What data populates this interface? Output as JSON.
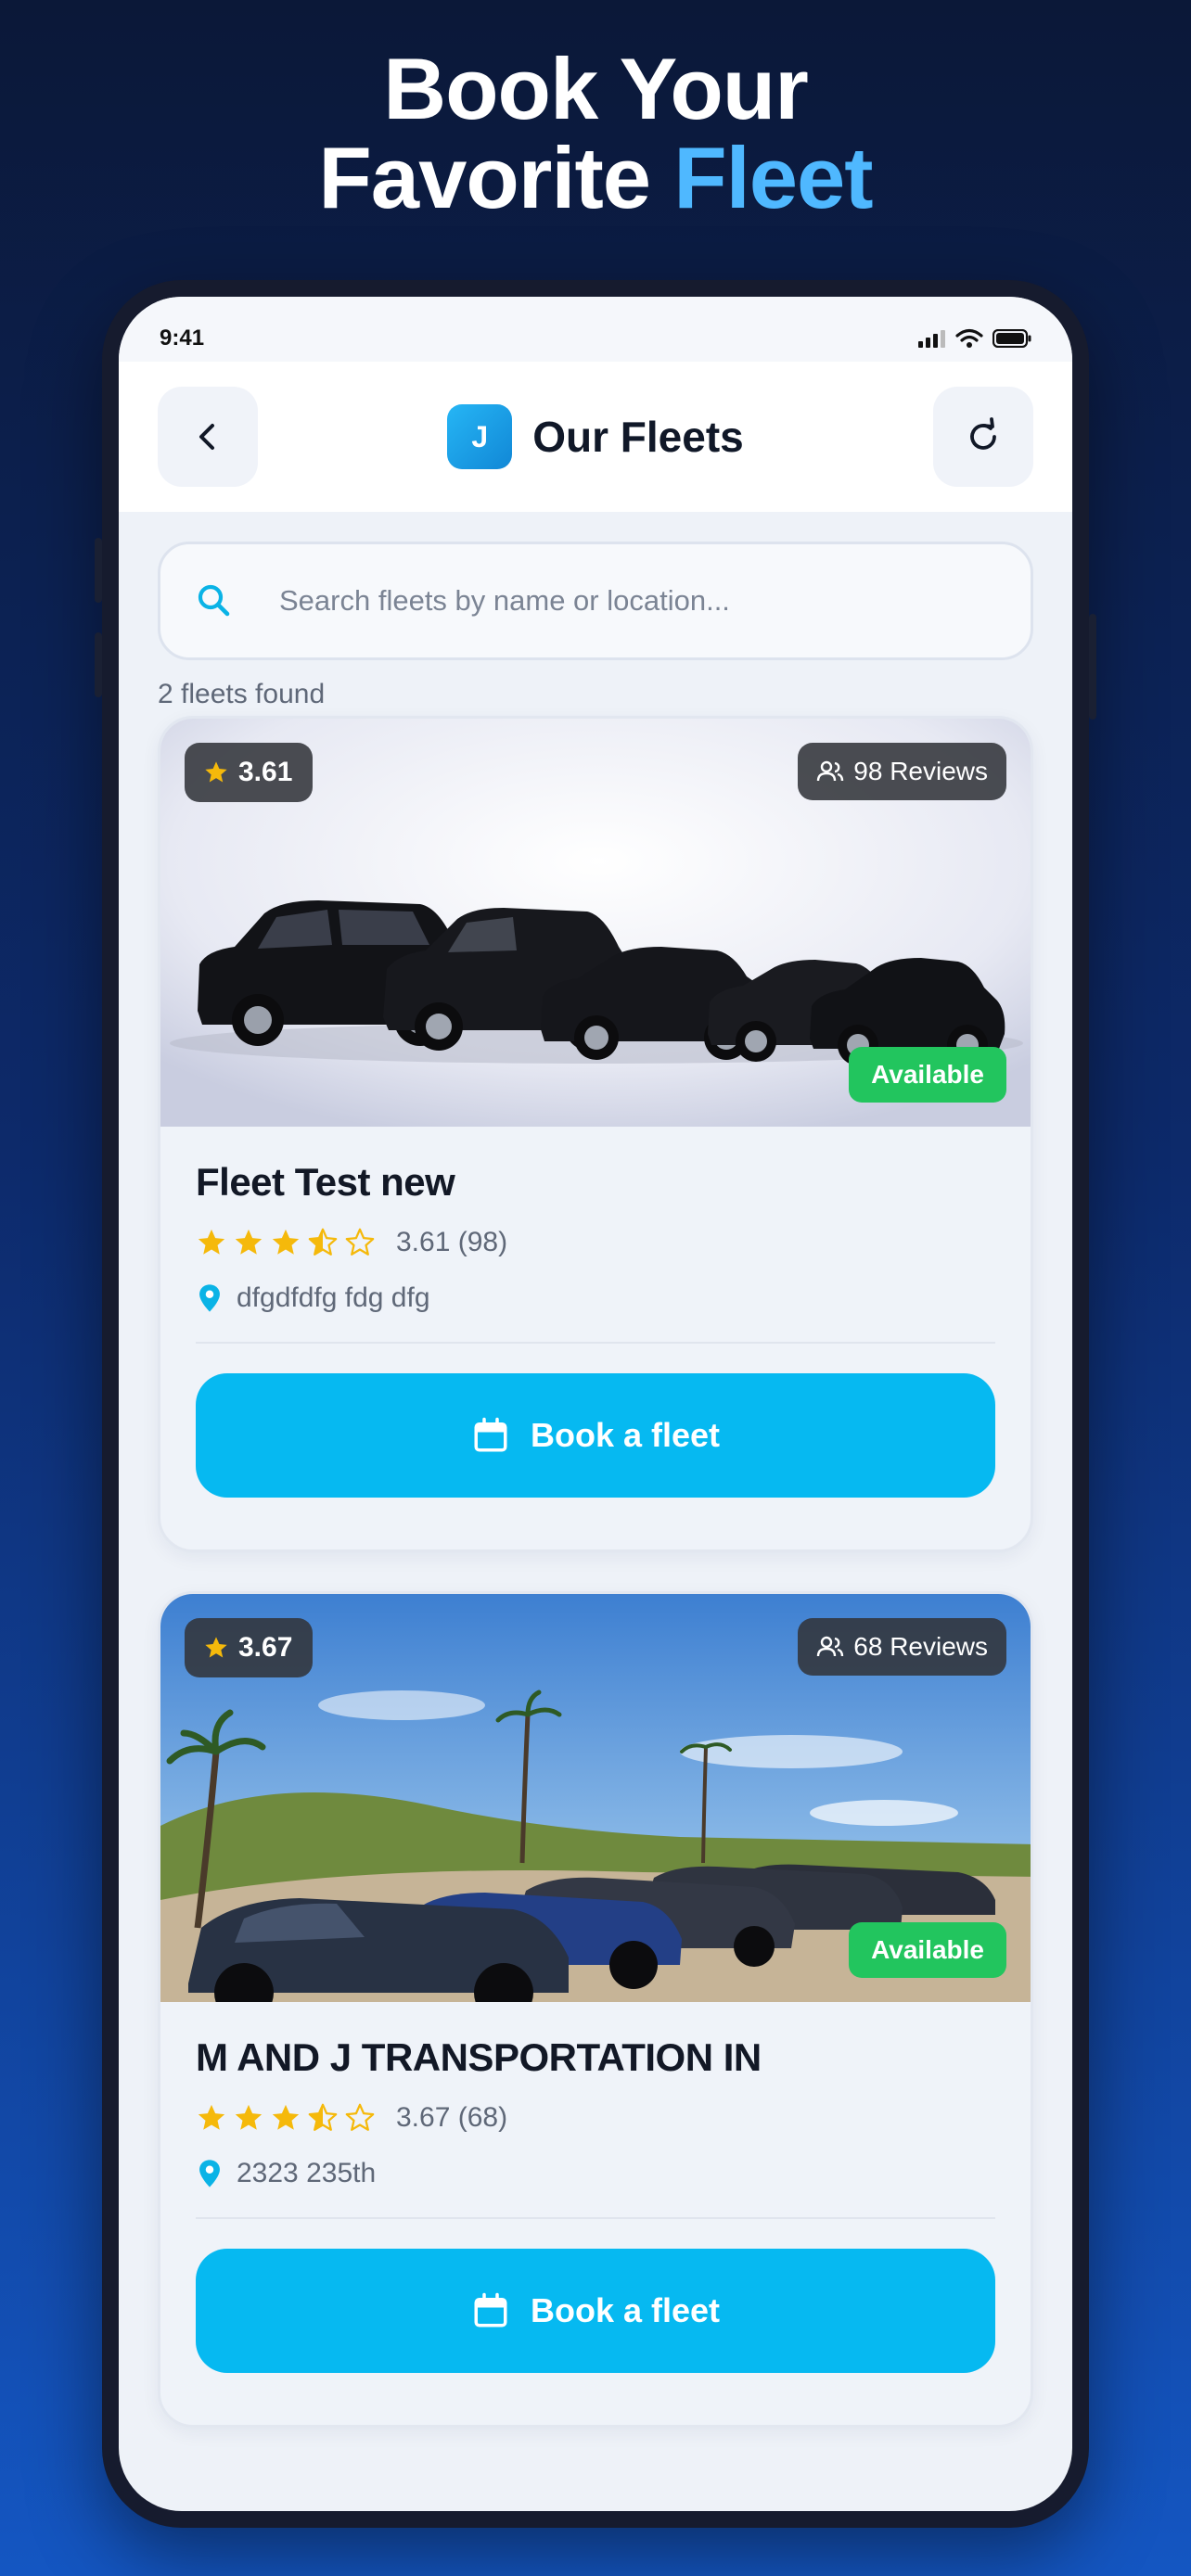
{
  "headline": {
    "line1": "Book Your",
    "line2_prefix": "Favorite ",
    "line2_accent": "Fleet"
  },
  "status_bar": {
    "time": "9:41"
  },
  "header": {
    "logo_letter": "J",
    "title": "Our Fleets"
  },
  "search": {
    "placeholder": "Search fleets by name or location...",
    "value": ""
  },
  "results": {
    "count_text": "2 fleets found"
  },
  "fleets": [
    {
      "rating_badge": "3.61",
      "reviews_badge": "98 Reviews",
      "status": "Available",
      "name": "Fleet Test new",
      "stars": 3.5,
      "rating_text": "3.61 (98)",
      "location": "dfgdfdfg fdg dfg",
      "book_label": "Book a fleet"
    },
    {
      "rating_badge": "3.67",
      "reviews_badge": "68 Reviews",
      "status": "Available",
      "name": "M AND J TRANSPORTATION IN",
      "stars": 3.5,
      "rating_text": "3.67 (68)",
      "location": "2323 235th",
      "book_label": "Book a fleet"
    }
  ],
  "colors": {
    "accent": "#06b9f1",
    "headline_accent": "#4fb8ff",
    "available": "#22c55e",
    "star": "#f5b90b",
    "pin": "#0ab3e6"
  }
}
